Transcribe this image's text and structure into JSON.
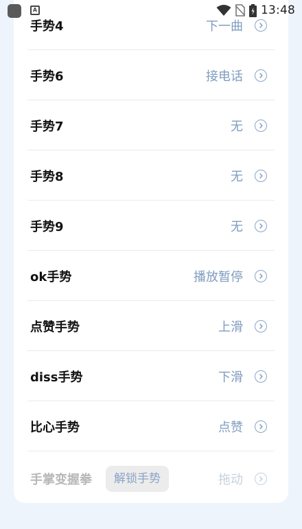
{
  "status_bar": {
    "a_icon": "A",
    "time": "13:48"
  },
  "gestures": [
    {
      "label": "手势4",
      "value": "下一曲"
    },
    {
      "label": "手势6",
      "value": "接电话"
    },
    {
      "label": "手势7",
      "value": "无"
    },
    {
      "label": "手势8",
      "value": "无"
    },
    {
      "label": "手势9",
      "value": "无"
    },
    {
      "label": "ok手势",
      "value": "播放暂停"
    },
    {
      "label": "点赞手势",
      "value": "上滑"
    },
    {
      "label": "diss手势",
      "value": "下滑"
    },
    {
      "label": "比心手势",
      "value": "点赞"
    },
    {
      "label": "手掌变握拳",
      "value": "拖动",
      "badge": "解锁手势"
    }
  ]
}
